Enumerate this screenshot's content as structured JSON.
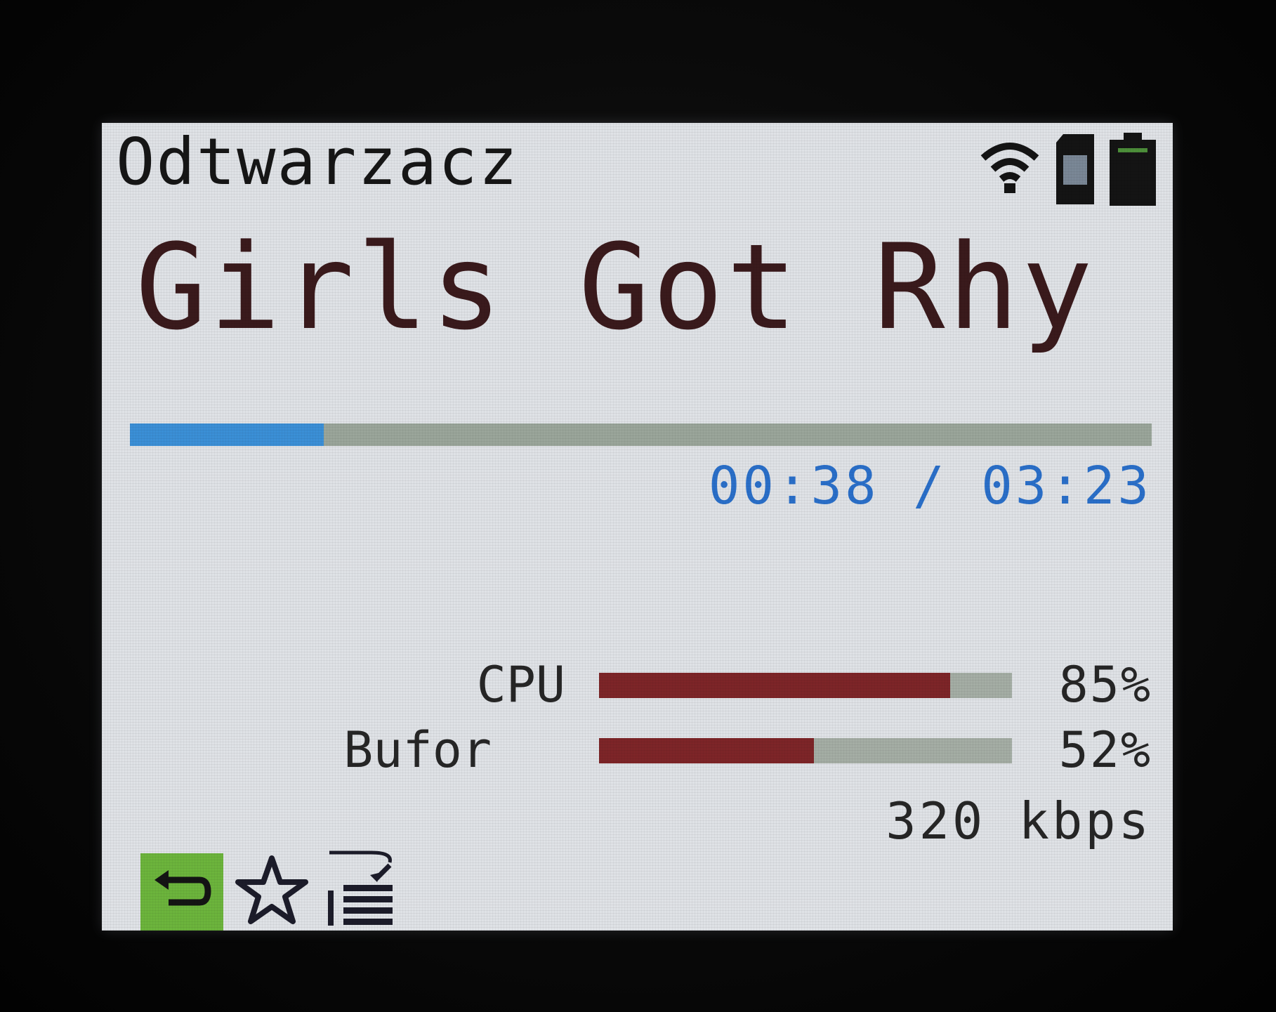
{
  "header": {
    "title": "Odtwarzacz",
    "icons": [
      "wifi-icon",
      "sd-card-icon",
      "battery-icon"
    ]
  },
  "player": {
    "track_title": "Girls Got Rhy",
    "progress": 0.19,
    "elapsed": "00:38",
    "separator": "/",
    "duration": "03:23",
    "time_display": "00:38 / 03:23"
  },
  "stats": {
    "cpu": {
      "label": "CPU",
      "value": "85%",
      "fraction": 0.85
    },
    "buffer": {
      "label": "Bufor",
      "value": "52%",
      "fraction": 0.52
    },
    "bitrate": "320 kbps"
  },
  "toolbar": {
    "items": [
      {
        "icon": "back-icon",
        "active": true
      },
      {
        "icon": "star-icon",
        "active": false
      },
      {
        "icon": "add-to-playlist-icon",
        "active": false
      }
    ]
  },
  "colors": {
    "screen_bg": "#dfe2e6",
    "progress_fill": "#3b8fd6",
    "meter_fill": "#7d2528",
    "active_button": "#6cb43c",
    "time_text": "#2a6fc9"
  }
}
